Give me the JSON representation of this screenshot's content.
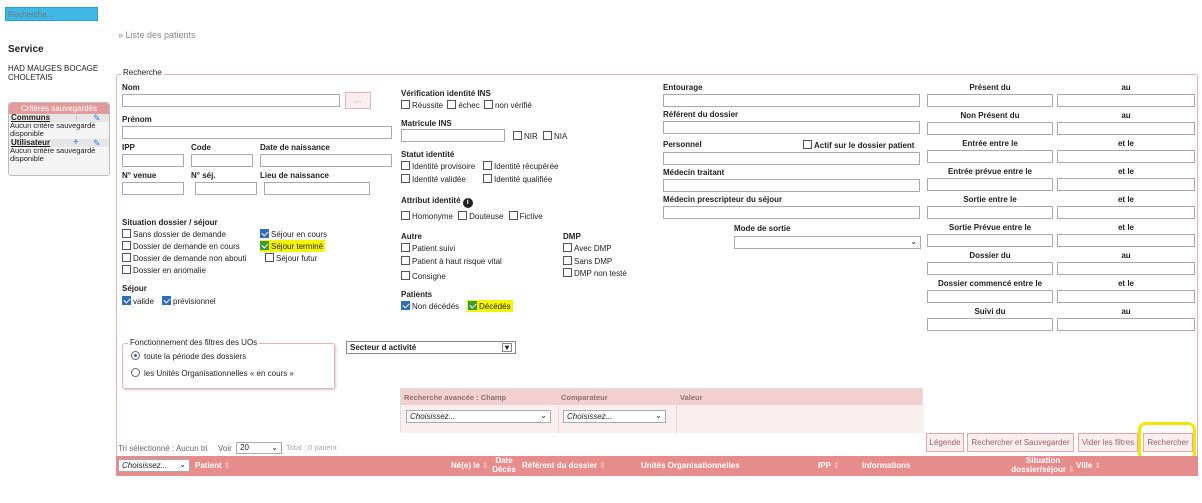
{
  "search": {
    "placeholder": "Recherche..."
  },
  "breadcrumb": "» Liste des patients",
  "sidebar": {
    "service_title": "Service",
    "service_name": "HAD MAUGES BOCAGE CHOLETAIS",
    "saved_criteria_title": "Critères sauvegardés",
    "communs_label": "Communs",
    "communs_empty": "Aucun critère sauvegardé disponible",
    "utilisateur_label": "Utilisateur",
    "utilisateur_empty": "Aucun critère sauvegardé disponible"
  },
  "form": {
    "legend": "Recherche",
    "nom": "Nom",
    "prenom": "Prénom",
    "ipp": "IPP",
    "code": "Code",
    "date_naissance": "Date de naissance",
    "num_venue": "N° venue",
    "num_sej": "N° séj.",
    "lieu_naissance": "Lieu de naissance",
    "situation_title": "Situation dossier / séjour",
    "situation": [
      {
        "label": "Sans dossier de demande",
        "checked": false
      },
      {
        "label": "Séjour en cours",
        "checked": true
      },
      {
        "label": "Dossier de demande en cours",
        "checked": false
      },
      {
        "label": "Séjour terminé",
        "checked": true
      },
      {
        "label": "Dossier de demande non abouti",
        "checked": false
      },
      {
        "label": "Séjour futur",
        "checked": false
      },
      {
        "label": "Dossier en anomalie",
        "checked": false
      }
    ],
    "sejour_title": "Séjour",
    "sejour": [
      {
        "label": "valide",
        "checked": true
      },
      {
        "label": "prévisionnel",
        "checked": true
      }
    ],
    "verif_title": "Vérification identité INS",
    "verif": [
      "Réussite",
      "échec",
      "non vérifié"
    ],
    "matricule_title": "Matricule INS",
    "matricule_opts": [
      "NIR",
      "NIA"
    ],
    "statut_title": "Statut identité",
    "statut": [
      "Identité provisoire",
      "Identité récupérée",
      "Identité validée",
      "Identité qualifiée"
    ],
    "attribut_title": "Attribut identité",
    "attribut": [
      "Homonyme",
      "Douteuse",
      "Fictive"
    ],
    "autre_title": "Autre",
    "autre": [
      "Patient suivi",
      "Patient à haut risque vital",
      "Consigne"
    ],
    "dmp_title": "DMP",
    "dmp": [
      "Avec DMP",
      "Sans DMP",
      "DMP non testé"
    ],
    "patients_title": "Patients",
    "patients": [
      {
        "label": "Non décédés",
        "checked": true
      },
      {
        "label": "Décédés",
        "checked": true
      }
    ],
    "entourage": "Entourage",
    "referent": "Référent du dossier",
    "personnel": "Personnel",
    "actif_label": "Actif sur le dossier patient",
    "medecin_traitant": "Médecin traitant",
    "medecin_prescripteur": "Médecin prescripteur du séjour",
    "mode_sortie": "Mode de sortie",
    "dates": [
      {
        "label": "Présent du",
        "sep": "au"
      },
      {
        "label": "Non Présent du",
        "sep": "au"
      },
      {
        "label": "Entrée entre le",
        "sep": "et le"
      },
      {
        "label": "Entrée prévue entre le",
        "sep": "et le"
      },
      {
        "label": "Sortie entre le",
        "sep": "et le"
      },
      {
        "label": "Sortie Prévue entre le",
        "sep": "et le"
      },
      {
        "label": "Dossier du",
        "sep": "au"
      },
      {
        "label": "Dossier commencé entre le",
        "sep": "et le"
      },
      {
        "label": "Suivi du",
        "sep": "au"
      }
    ]
  },
  "uo_filter": {
    "legend": "Fonctionnement des filtres des UOs",
    "options": [
      "toute la période des dossiers",
      "les Unités Organisationnelles « en cours »"
    ]
  },
  "secteur_label": "Secteur d activité",
  "advanced": {
    "champ_header": "Recherche avancée : Champ",
    "comparateur_header": "Comparateur",
    "valeur_header": "Valeur",
    "champ_value": "Choisissez...",
    "comparateur_value": "Choisissez..."
  },
  "buttons": {
    "legende": "Légende",
    "rechercher_sauvegarder": "Rechercher et Sauvegarder",
    "vider": "Vider les filtres",
    "rechercher": "Rechercher"
  },
  "results": {
    "tri": "Tri sélectionné : Aucun tri",
    "voir": "Voir",
    "per_page": "20",
    "total": "Total : 0 patient"
  },
  "table": {
    "select_value": "Choisissez...",
    "headers": [
      "Patient",
      "Né(e) le",
      "Date Décès",
      "Référent du dossier",
      "Unités Organisationnelles",
      "IPP",
      "Informations",
      "Situation dossier/séjour",
      "Ville"
    ]
  }
}
